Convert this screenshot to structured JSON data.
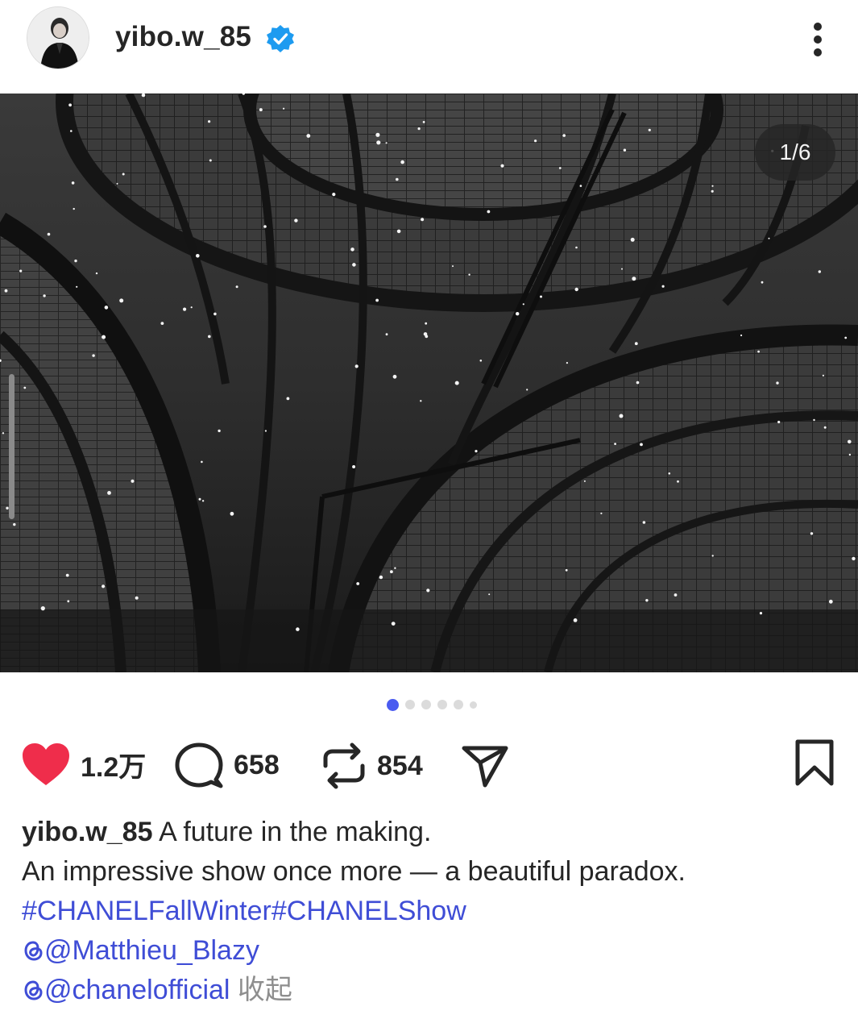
{
  "header": {
    "username": "yibo.w_85",
    "verified": true
  },
  "post": {
    "counter": "1/6",
    "slide_count": 6,
    "active_slide": 1
  },
  "actions": {
    "like_count": "1.2万",
    "comment_count": "658",
    "repost_count": "854",
    "like_color": "#ef2d4b"
  },
  "caption": {
    "username": "yibo.w_85",
    "line1": "A future in the making.",
    "line2": "An impressive show once more — a beautiful paradox.",
    "hashtag1": "#CHANELFallWinter",
    "hashtag2": "#CHANELShow",
    "mention1": "@Matthieu_Blazy",
    "mention2": "@chanelofficial",
    "collapse": "收起"
  },
  "colors": {
    "link": "#3f4dd6",
    "dot_active": "#4a5bf0",
    "verified": "#1d9bf0"
  }
}
